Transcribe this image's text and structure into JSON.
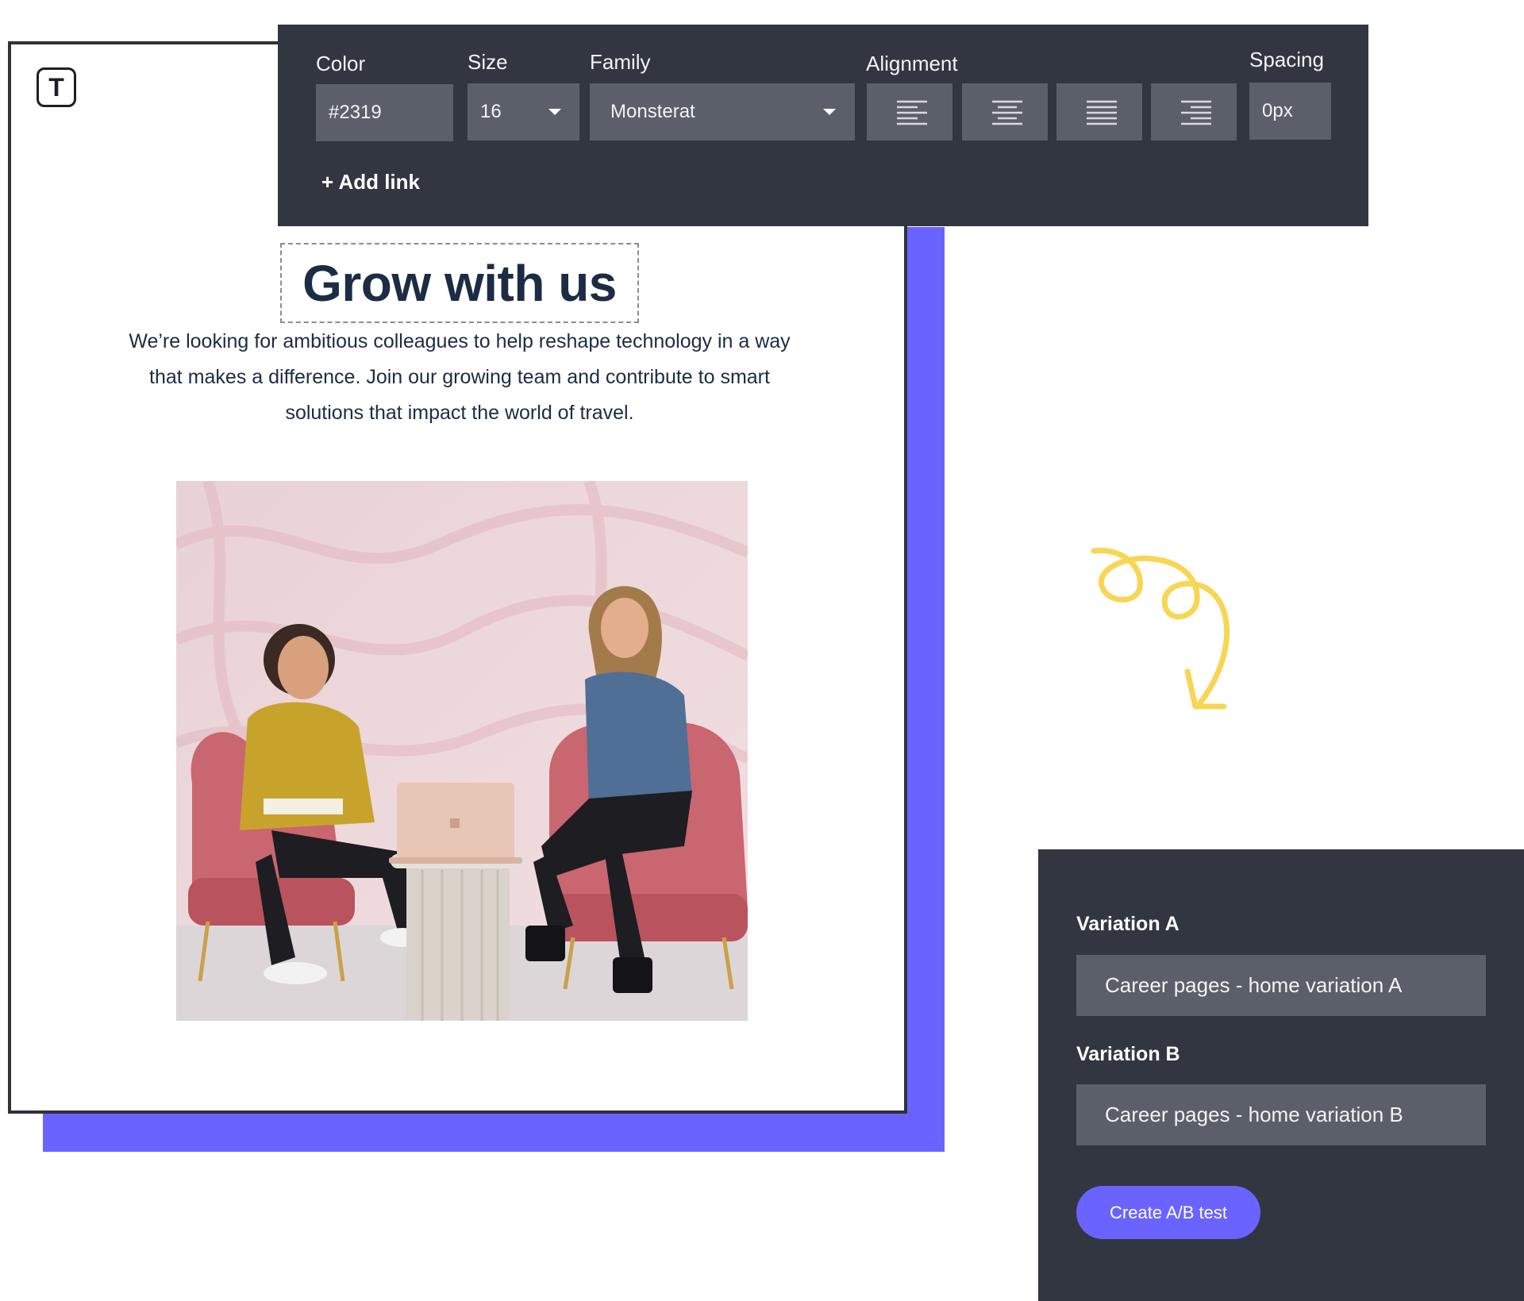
{
  "editor": {
    "text_tool_icon": "T",
    "headline": "Grow with us",
    "body_lines": [
      "We’re looking for ambitious colleagues to help reshape technology in a way",
      "that makes a difference. Join our growing team and contribute to smart",
      "solutions that impact the world of travel."
    ],
    "image_alt": "Two women chatting in pink armchairs with a laptop on a small table"
  },
  "toolbar": {
    "color": {
      "label": "Color",
      "value": "#2319"
    },
    "size": {
      "label": "Size",
      "value": "16"
    },
    "family": {
      "label": "Family",
      "value": "Monsterat"
    },
    "alignment": {
      "label": "Alignment",
      "options": [
        "align-left-icon",
        "align-center-icon",
        "align-justify-icon",
        "align-right-icon"
      ]
    },
    "spacing": {
      "label": "Spacing",
      "value": "0px"
    },
    "add_link": "+ Add link"
  },
  "ab_test": {
    "variation_a": {
      "label": "Variation A",
      "value": "Career pages - home variation A"
    },
    "variation_b": {
      "label": "Variation B",
      "value": "Career pages - home variation B"
    },
    "button": "Create A/B test"
  },
  "colors": {
    "accent": "#6b63ff",
    "toolbar_bg": "#323641",
    "field_bg": "#5b5f6a",
    "headline": "#1d2c44",
    "squiggle": "#f7d654"
  }
}
